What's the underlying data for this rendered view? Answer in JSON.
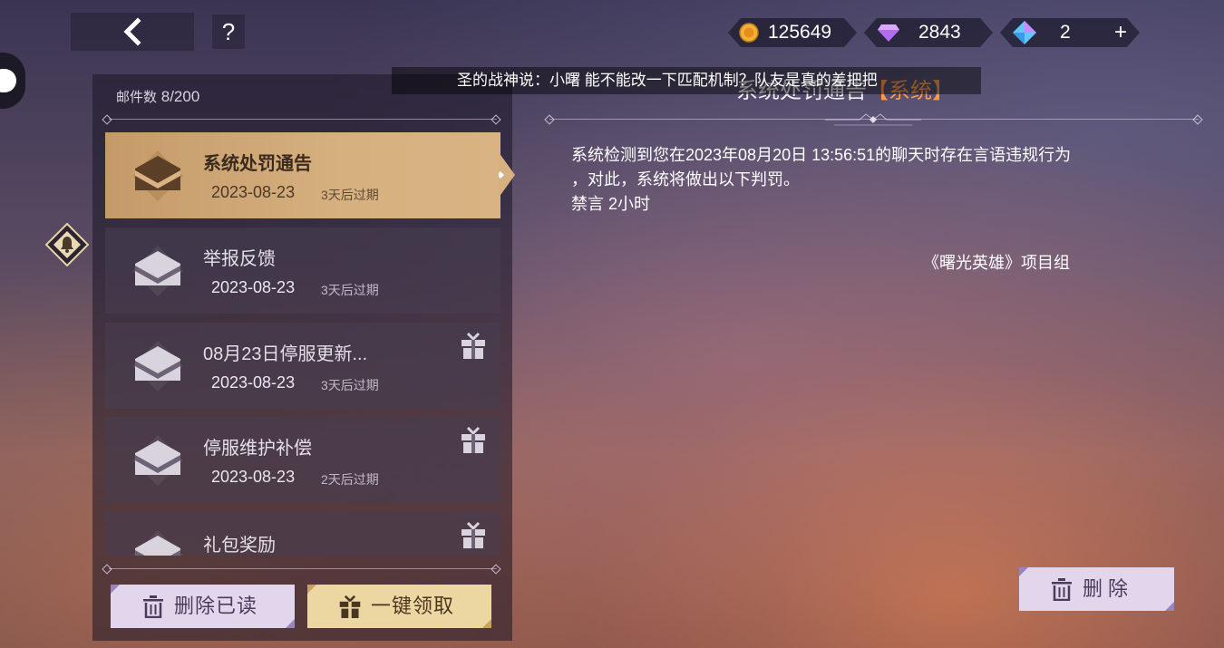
{
  "header": {
    "back_icon": "chevron-left-icon",
    "help_label": "?"
  },
  "currency": {
    "gold": {
      "icon": "gold-coin-icon",
      "value": "125649"
    },
    "gem": {
      "icon": "purple-gem-icon",
      "value": "2843"
    },
    "crystal": {
      "icon": "blue-crystal-icon",
      "value": "2",
      "plus": "+"
    }
  },
  "marquee": {
    "text": "圣的战神说：小曙 能不能改一下匹配机制？队友是真的差把把"
  },
  "mailbox": {
    "count_label": "邮件数",
    "count_value": "8/200",
    "items": [
      {
        "title": "系统处罚通告",
        "date": "2023-08-23",
        "expiry": "3天后过期",
        "has_gift": false,
        "selected": true
      },
      {
        "title": "举报反馈",
        "date": "2023-08-23",
        "expiry": "3天后过期",
        "has_gift": false,
        "selected": false
      },
      {
        "title": "08月23日停服更新...",
        "date": "2023-08-23",
        "expiry": "3天后过期",
        "has_gift": true,
        "selected": false
      },
      {
        "title": "停服维护补偿",
        "date": "2023-08-23",
        "expiry": "2天后过期",
        "has_gift": true,
        "selected": false
      },
      {
        "title": "礼包奖励",
        "date": "",
        "expiry": "",
        "has_gift": true,
        "selected": false
      }
    ],
    "delete_read_label": "删除已读",
    "claim_all_label": "一键领取"
  },
  "detail": {
    "title": "系统处罚通告",
    "tag": "【系统】",
    "body_line1": "系统检测到您在2023年08月20日 13:56:51的聊天时存在言语违规行为",
    "body_line2": "，对此，系统将做出以下判罚。",
    "body_line3": "禁言 2小时",
    "signature": "《曙光英雄》项目组",
    "delete_label": "删除"
  },
  "colors": {
    "selected_item": "#d7b080",
    "tag": "#ff9a4a",
    "button_lilac": "#e1d6ec",
    "button_gold": "#ecd6a2"
  }
}
